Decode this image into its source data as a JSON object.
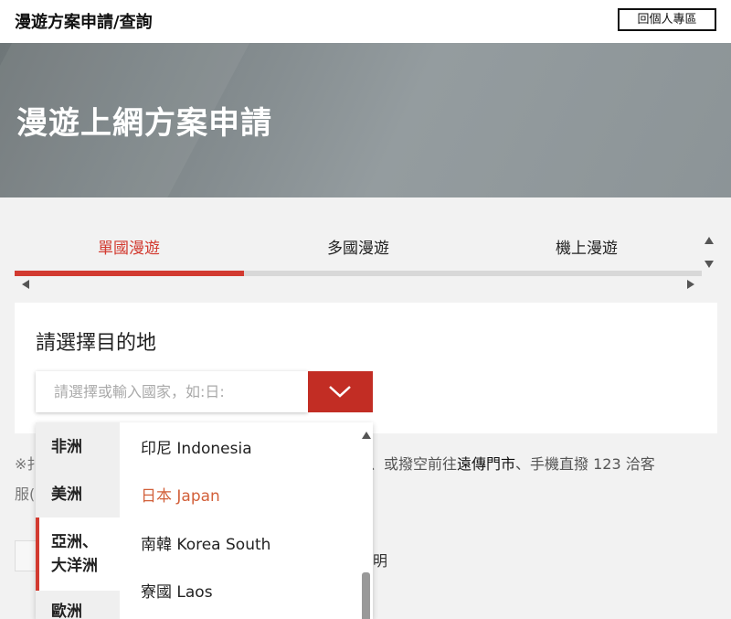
{
  "header": {
    "title": "漫遊方案申請/查詢",
    "back_button": "回個人專區"
  },
  "hero": {
    "title": "漫遊上網方案申請"
  },
  "tabs": [
    {
      "label": "單國漫遊",
      "active": true
    },
    {
      "label": "多國漫遊",
      "active": false
    },
    {
      "label": "機上漫遊",
      "active": false
    }
  ],
  "destination": {
    "title": "請選擇目的地",
    "placeholder": "請選擇或輸入國家，如:日:"
  },
  "dropdown": {
    "regions": [
      {
        "label": "非洲",
        "active": false
      },
      {
        "label": "美洲",
        "active": false
      },
      {
        "label": "亞洲、\n大洋洲",
        "line1": "亞洲、",
        "line2": "大洋洲",
        "active": true
      },
      {
        "label": "歐洲",
        "active": false
      }
    ],
    "countries": [
      {
        "label": "印尼 Indonesia",
        "selected": false
      },
      {
        "label": "日本 Japan",
        "selected": true
      },
      {
        "label": "南韓 Korea South",
        "selected": false
      },
      {
        "label": "寮國 Laos",
        "selected": false
      }
    ]
  },
  "notes": {
    "prefix": "※扌",
    "line1_tail": "碼、或撥空前往",
    "store": "遠傳門市",
    "line1_end": "、手機直撥 123 洽客",
    "line2": "服(",
    "checkbox_label": "明"
  },
  "colors": {
    "accent": "#d23a30",
    "button": "#c22d24"
  }
}
